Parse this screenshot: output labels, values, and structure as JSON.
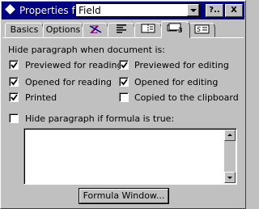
{
  "titlebar": {
    "label": "Properties for:",
    "selected": "Field",
    "help_button": "?..",
    "close_button": "X"
  },
  "tabs": [
    {
      "label": "Basics"
    },
    {
      "label": "Options"
    },
    {
      "label": "",
      "icon": "font-icon"
    },
    {
      "label": "",
      "icon": "paragraph-alignment-icon"
    },
    {
      "label": "",
      "icon": "page-break-icon"
    },
    {
      "label": "",
      "icon": "hide-when-icon",
      "active": true
    },
    {
      "label": "",
      "icon": "style-icon"
    }
  ],
  "section": {
    "heading": "Hide paragraph when document is:",
    "checks": [
      {
        "label": "Previewed for reading",
        "checked": true
      },
      {
        "label": "Previewed for editing",
        "checked": true
      },
      {
        "label": "Opened for reading",
        "checked": true
      },
      {
        "label": "Opened for editing",
        "checked": true
      },
      {
        "label": "Printed",
        "checked": true
      },
      {
        "label": "Copied to the clipboard",
        "checked": false
      }
    ],
    "formula_check": {
      "label": "Hide paragraph if formula is true:",
      "checked": false
    },
    "formula_value": ""
  },
  "formula_button": "Formula Window..."
}
